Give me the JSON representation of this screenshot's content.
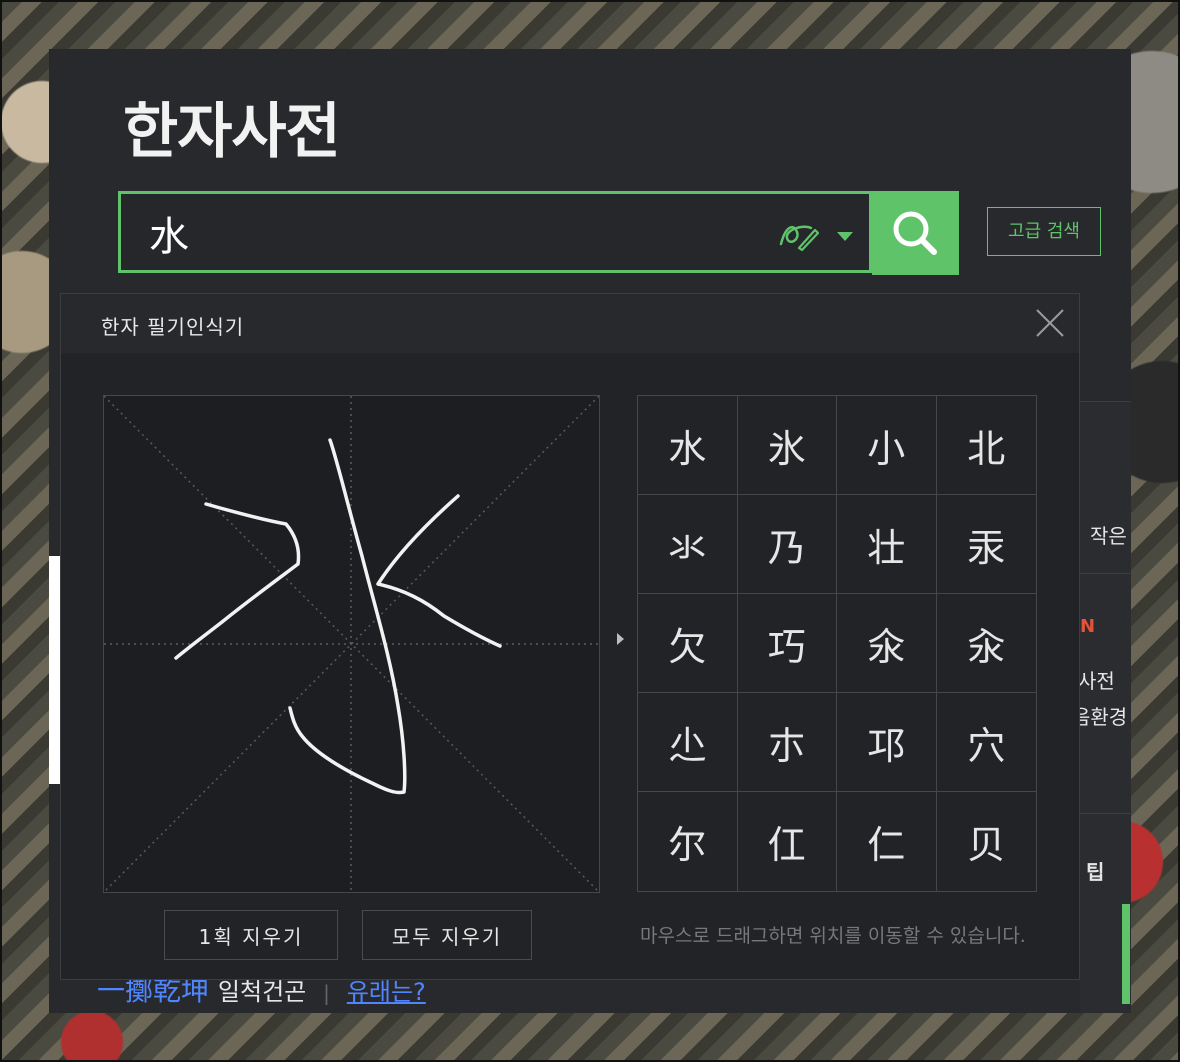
{
  "page": {
    "title": "한자사전"
  },
  "search": {
    "value": "水",
    "button_label": "검색",
    "advanced_label": "고급 검색"
  },
  "popup": {
    "title": "한자 필기인식기",
    "candidates": [
      "水",
      "氷",
      "小",
      "北",
      "氺",
      "乃",
      "壮",
      "汞",
      "欠",
      "巧",
      "氽",
      "汆",
      "尐",
      "朩",
      "邛",
      "穴",
      "尔",
      "仜",
      "仁",
      "贝"
    ],
    "undo_label": "1획 지우기",
    "clear_label": "모두 지우기",
    "hint": "마우스로 드래그하면 위치를 이동할 수 있습니다."
  },
  "background": {
    "right_texts": [
      "작은",
      "N",
      "사전",
      "음환경",
      "팁"
    ],
    "bottom_hanja": "一擲乾坤",
    "bottom_meaning": "일척건곤",
    "bottom_link": "유래는?"
  },
  "colors": {
    "accent": "#5fc36a",
    "panel": "#28292d",
    "popup": "#222326",
    "link": "#4f86ff"
  },
  "icons": {
    "pen": "pen-icon",
    "dropdown": "caret-down-icon",
    "search": "search-icon",
    "close": "close-icon",
    "arrow": "triangle-right-icon"
  }
}
